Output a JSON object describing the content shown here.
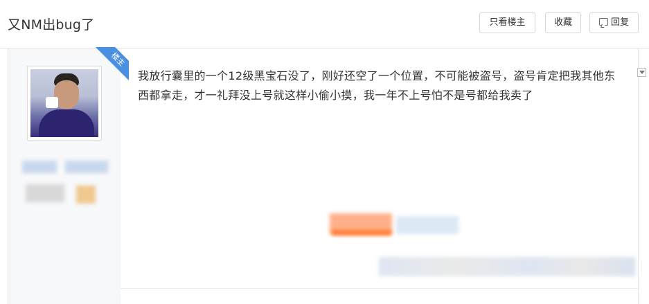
{
  "thread": {
    "title": "又NM出bug了"
  },
  "toolbar": {
    "louzhu_label": "只看楼主",
    "collect_label": "收藏",
    "reply_label": "回复"
  },
  "post": {
    "badge": "楼主",
    "content": "我放行囊里的一个12级黑宝石没了，刚好还空了一个位置，不可能被盗号，盗号肯定把我其他东西都拿走，才一礼拜没上号就这样小偷小摸，我一年不上号怕不是号都给我卖了"
  },
  "icons": {
    "reply": "reply-icon",
    "menu": "dropdown-icon"
  },
  "colors": {
    "accent": "#4a90e2",
    "orange": "#ff7a33"
  }
}
